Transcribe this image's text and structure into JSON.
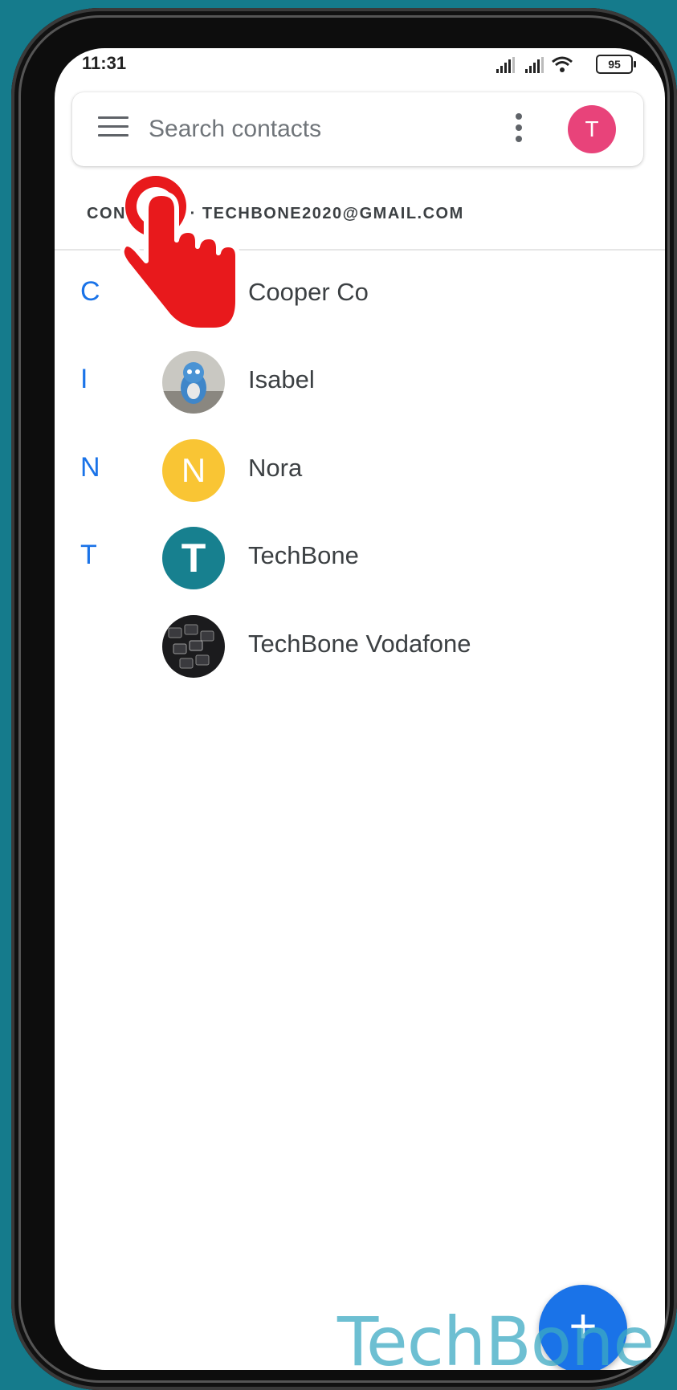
{
  "status_bar": {
    "time": "11:31",
    "battery": "95",
    "icons": [
      "signal-icon",
      "signal-icon",
      "wifi-icon",
      "battery-icon"
    ]
  },
  "search": {
    "placeholder": "Search contacts"
  },
  "account": {
    "avatar_letter": "T",
    "label": "CONTACTS · TECHBONE2020@GMAIL.COM",
    "avatar_color": "#e8437a"
  },
  "contacts": [
    {
      "index_letter": "C",
      "name": "Cooper Co",
      "avatar": "photo"
    },
    {
      "index_letter": "I",
      "name": "Isabel",
      "avatar": "photo"
    },
    {
      "index_letter": "N",
      "name": "Nora",
      "avatar_letter": "N",
      "avatar_color": "#f9c534"
    },
    {
      "index_letter": "T",
      "name": "TechBone",
      "avatar_letter": "T",
      "avatar_color": "#17808f"
    },
    {
      "index_letter": "",
      "name": "TechBone Vodafone",
      "avatar": "photo"
    }
  ],
  "fab": {
    "label": "+"
  },
  "watermark": "TechBone",
  "colors": {
    "accent": "#1a73e8",
    "background": "#157b8c",
    "tap_indicator": "#e8191c"
  }
}
